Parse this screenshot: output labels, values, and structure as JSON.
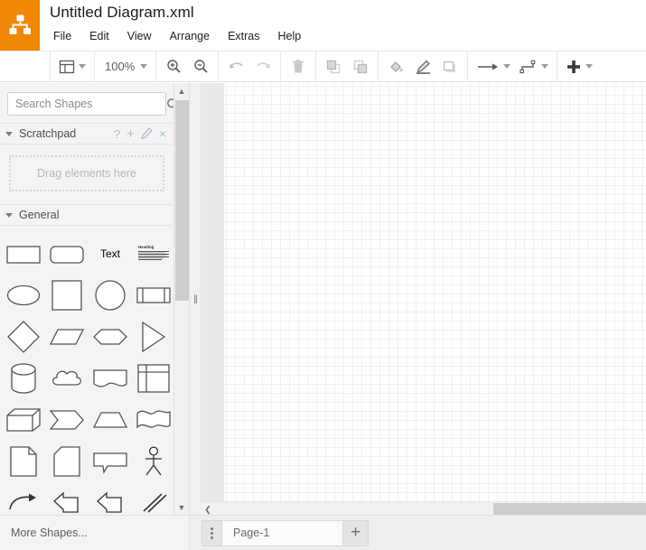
{
  "app": {
    "title": "Untitled Diagram.xml",
    "logo_icon": "drawio-node-tree-logo",
    "brand_color": "#F08705"
  },
  "menubar": {
    "items": [
      {
        "label": "File"
      },
      {
        "label": "Edit"
      },
      {
        "label": "View"
      },
      {
        "label": "Arrange"
      },
      {
        "label": "Extras"
      },
      {
        "label": "Help"
      }
    ]
  },
  "toolbar": {
    "view_layout": {
      "icon": "layout-panels-icon",
      "has_caret": true
    },
    "zoom": {
      "value": "100%",
      "has_caret": true
    },
    "zoom_in": {
      "icon": "zoom-in-icon"
    },
    "zoom_out": {
      "icon": "zoom-out-icon"
    },
    "undo": {
      "icon": "undo-icon"
    },
    "redo": {
      "icon": "redo-icon"
    },
    "delete": {
      "icon": "trash-icon"
    },
    "to_front": {
      "icon": "bring-to-front-icon"
    },
    "to_back": {
      "icon": "send-to-back-icon"
    },
    "fill_color": {
      "icon": "fill-bucket-icon"
    },
    "line_color": {
      "icon": "line-pen-icon"
    },
    "shadow": {
      "icon": "shadow-rect-icon"
    },
    "connection_arrow": {
      "icon": "arrow-right-icon",
      "has_caret": true
    },
    "waypoints": {
      "icon": "edge-waypoint-icon",
      "has_caret": true
    },
    "insert": {
      "icon": "plus-icon",
      "has_caret": true
    }
  },
  "sidebar": {
    "search": {
      "placeholder": "Search Shapes",
      "value": "",
      "icon": "search-icon"
    },
    "scratchpad": {
      "title": "Scratchpad",
      "collapsed": false,
      "actions": [
        {
          "name": "help",
          "glyph": "?"
        },
        {
          "name": "add",
          "glyph": "+"
        },
        {
          "name": "edit",
          "glyph": "pencil"
        },
        {
          "name": "close",
          "glyph": "×"
        }
      ],
      "dropzone_label": "Drag elements here"
    },
    "general": {
      "title": "General",
      "collapsed": false,
      "shapes": [
        [
          {
            "name": "rectangle",
            "icon": "rectangle-shape"
          },
          {
            "name": "rounded-rectangle",
            "icon": "rounded-rectangle-shape"
          },
          {
            "name": "text",
            "icon": "text-shape",
            "label": "Text"
          },
          {
            "name": "textbox",
            "icon": "textbox-shape"
          }
        ],
        [
          {
            "name": "ellipse",
            "icon": "ellipse-shape"
          },
          {
            "name": "square",
            "icon": "square-shape"
          },
          {
            "name": "circle",
            "icon": "circle-shape"
          },
          {
            "name": "process",
            "icon": "process-shape"
          }
        ],
        [
          {
            "name": "diamond",
            "icon": "diamond-shape"
          },
          {
            "name": "parallelogram",
            "icon": "parallelogram-shape"
          },
          {
            "name": "hexagon",
            "icon": "hexagon-shape"
          },
          {
            "name": "triangle",
            "icon": "triangle-shape"
          }
        ],
        [
          {
            "name": "cylinder",
            "icon": "cylinder-shape"
          },
          {
            "name": "cloud",
            "icon": "cloud-shape"
          },
          {
            "name": "document",
            "icon": "document-shape"
          },
          {
            "name": "internal-storage",
            "icon": "internal-storage-shape"
          }
        ],
        [
          {
            "name": "cube",
            "icon": "cube-shape"
          },
          {
            "name": "step",
            "icon": "step-shape"
          },
          {
            "name": "trapezoid",
            "icon": "trapezoid-shape"
          },
          {
            "name": "tape",
            "icon": "tape-shape"
          }
        ],
        [
          {
            "name": "note",
            "icon": "note-shape"
          },
          {
            "name": "card",
            "icon": "card-shape"
          },
          {
            "name": "callout",
            "icon": "callout-shape"
          },
          {
            "name": "actor",
            "icon": "actor-shape"
          }
        ],
        [
          {
            "name": "curved-arrow",
            "icon": "curved-arrow-shape"
          },
          {
            "name": "arrow-left-up",
            "icon": "arrow-left-up-shape"
          },
          {
            "name": "arrow-right-up",
            "icon": "arrow-right-up-shape"
          },
          {
            "name": "double-line",
            "icon": "double-line-shape"
          }
        ]
      ]
    },
    "more_shapes_label": "More Shapes..."
  },
  "canvas": {
    "grid": true,
    "background": "#ffffff"
  },
  "scrollbars": {
    "vertical_up": "▲",
    "vertical_down": "▼",
    "horizontal_left": "❮"
  },
  "splitter": {
    "grip": "||"
  },
  "footer": {
    "page_menu_icon": "vertical-dots-icon",
    "pages": [
      {
        "label": "Page-1",
        "active": true
      }
    ],
    "add_page_glyph": "+"
  }
}
